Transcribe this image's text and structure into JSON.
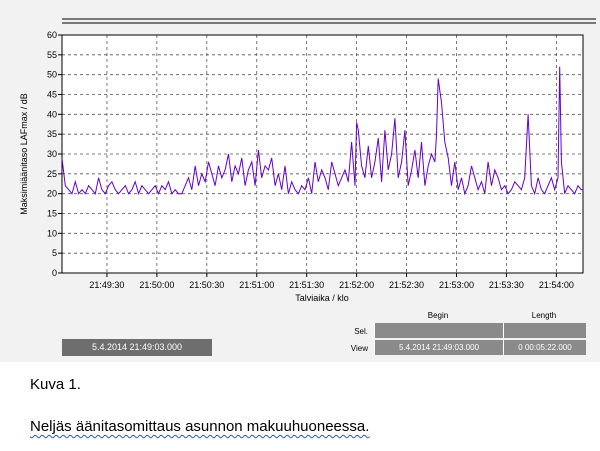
{
  "chart_data": {
    "type": "line",
    "ylabel": "Maksimiäänitaso LAFmax / dB",
    "xlabel": "Talviaika / klo",
    "ylim": [
      0,
      60
    ],
    "yticks": [
      0,
      5,
      10,
      15,
      20,
      25,
      30,
      35,
      40,
      45,
      50,
      55,
      60
    ],
    "xlim_seconds_after_start": [
      0,
      313
    ],
    "xtick_labels": [
      "21:49:30",
      "21:50:00",
      "21:50:30",
      "21:51:00",
      "21:51:30",
      "21:52:00",
      "21:52:30",
      "21:53:00",
      "21:53:30",
      "21:54:00"
    ],
    "xtick_seconds_after_start": [
      27,
      57,
      87,
      117,
      147,
      177,
      207,
      237,
      267,
      297
    ],
    "grid": true,
    "line_color": "#6600cc",
    "series": [
      {
        "name": "",
        "x": [
          0,
          2,
          4,
          6,
          8,
          10,
          12,
          14,
          16,
          18,
          20,
          22,
          24,
          26,
          28,
          30,
          32,
          34,
          36,
          38,
          40,
          42,
          44,
          46,
          48,
          50,
          52,
          54,
          56,
          58,
          60,
          62,
          64,
          66,
          68,
          70,
          72,
          74,
          76,
          78,
          80,
          82,
          84,
          86,
          88,
          90,
          92,
          94,
          96,
          98,
          100,
          102,
          104,
          106,
          108,
          110,
          112,
          114,
          116,
          118,
          120,
          122,
          124,
          126,
          128,
          130,
          132,
          134,
          136,
          138,
          140,
          142,
          144,
          146,
          148,
          150,
          152,
          154,
          156,
          158,
          160,
          162,
          164,
          166,
          168,
          170,
          172,
          174,
          176,
          177,
          178,
          180,
          182,
          184,
          186,
          188,
          190,
          192,
          194,
          196,
          198,
          200,
          202,
          204,
          206,
          208,
          210,
          212,
          214,
          216,
          218,
          220,
          222,
          224,
          225,
          226,
          227,
          228,
          230,
          232,
          234,
          236,
          238,
          240,
          242,
          244,
          246,
          248,
          250,
          252,
          254,
          256,
          258,
          260,
          262,
          264,
          266,
          268,
          270,
          272,
          274,
          276,
          278,
          280,
          282,
          284,
          286,
          288,
          290,
          292,
          294,
          296,
          298,
          299,
          300,
          302,
          304,
          306,
          308,
          310,
          312,
          313
        ],
        "y": [
          29,
          22,
          21,
          20,
          23,
          20,
          21,
          20,
          22,
          21,
          20,
          24,
          21,
          20,
          22,
          23,
          21,
          20,
          21,
          22,
          20,
          21,
          23,
          20,
          22,
          21,
          20,
          21,
          22,
          20,
          22,
          21,
          23,
          20,
          21,
          20,
          20,
          22,
          24,
          21,
          27,
          22,
          25,
          23,
          28,
          25,
          22,
          27,
          24,
          26,
          30,
          23,
          27,
          25,
          29,
          22,
          26,
          28,
          22,
          31,
          24,
          27,
          26,
          29,
          22,
          25,
          21,
          27,
          20,
          23,
          21,
          20,
          22,
          21,
          24,
          20,
          28,
          23,
          26,
          24,
          21,
          28,
          25,
          22,
          24,
          26,
          23,
          33,
          22,
          38,
          36,
          27,
          24,
          32,
          24,
          28,
          34,
          23,
          36,
          26,
          30,
          39,
          24,
          28,
          36,
          22,
          26,
          31,
          24,
          33,
          22,
          27,
          30,
          28,
          35,
          49,
          46,
          43,
          33,
          29,
          22,
          28,
          21,
          24,
          20,
          22,
          27,
          24,
          21,
          23,
          20,
          28,
          22,
          26,
          24,
          21,
          22,
          20,
          21,
          23,
          22,
          21,
          24,
          40,
          22,
          20,
          24,
          21,
          20,
          22,
          24,
          21,
          24,
          52,
          28,
          20,
          22,
          21,
          20,
          22,
          21,
          21
        ]
      }
    ]
  },
  "info": {
    "start_time": "5.4.2014 21:49:03.000",
    "begin_header": "Begin",
    "length_header": "Length",
    "sel_label": "Sel.",
    "view_label": "View",
    "view_begin": "5.4.2014 21:49:03.000",
    "view_length": "0 00:05:22.000"
  },
  "caption": {
    "title": "Kuva 1.",
    "text": "Neljäs äänitasomittaus asunnon makuuhuoneessa."
  }
}
